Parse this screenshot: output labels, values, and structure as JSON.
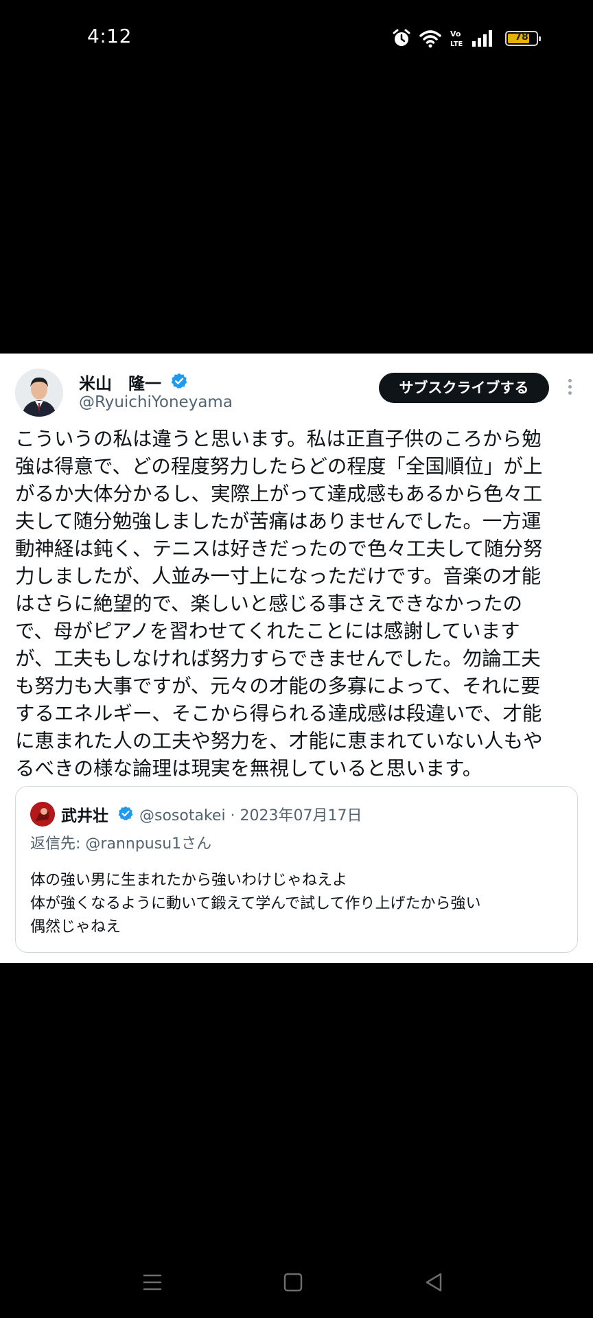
{
  "status_bar": {
    "time": "4:12",
    "icons": [
      "alarm-icon",
      "wifi-icon",
      "volte-icon",
      "signal-icon"
    ],
    "volte_label": "Vo\nLTE",
    "battery": "78",
    "battery_level": 0.78
  },
  "tweet": {
    "author_name": "米山　隆一",
    "author_handle": "@RyuichiYoneyama",
    "subscribe_label": "サブスクライブする",
    "text": "こういうの私は違うと思います。私は正直子供のころから勉\n強は得意で、どの程度努力したらどの程度「全国順位」が上\nがるか大体分かるし、実際上がって達成感もあるから色々工\n夫して随分勉強しましたが苦痛はありませんでした。一方運\n動神経は鈍く、テニスは好きだったので色々工夫して随分努\n力しましたが、人並み一寸上になっただけです。音楽の才能\nはさらに絶望的で、楽しいと感じる事さえできなかったの\nで、母がピアノを習わせてくれたことには感謝しています\nが、工夫もしなければ努力すらできませんでした。勿論工夫\nも努力も大事ですが、元々の才能の多寡によって、それに要\nするエネルギー、そこから得られる達成感は段違いで、才能\nに恵まれた人の工夫や努力を、才能に恵まれていない人もや\nるべきの様な論理は現実を無視していると思います。",
    "quote": {
      "author_name": "武井壮",
      "handle_date": "@sosotakei · 2023年07月17日",
      "reply_to": "返信先: @rannpusu1さん",
      "text": "体の強い男に生まれたから強いわけじゃねえよ\n体が強くなるように動いて鍛えて学んで試して作り上げたから強い\n偶然じゃねえ"
    }
  },
  "colors": {
    "verified": "#1d9bf0",
    "secondary_text": "#536471",
    "primary_text": "#0f1419",
    "subscribe_bg": "#0f1419"
  },
  "nav_bar": {
    "buttons": [
      "menu-icon",
      "home-square-icon",
      "back-triangle-icon"
    ]
  }
}
